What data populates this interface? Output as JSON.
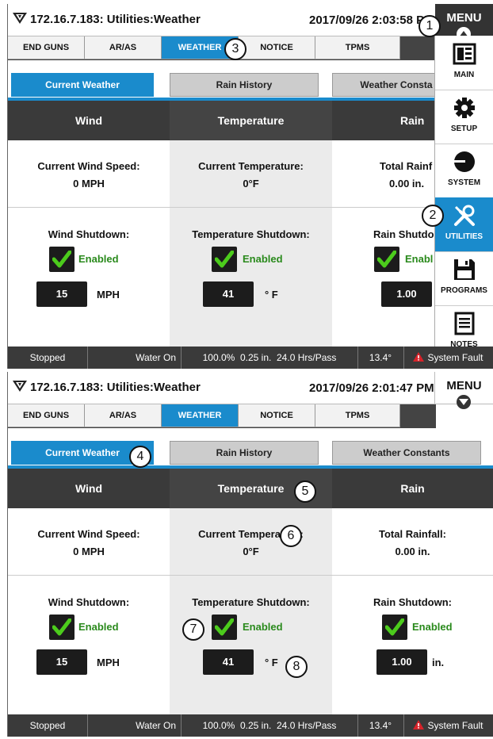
{
  "screens": [
    {
      "title": "172.16.7.183: Utilities:Weather",
      "datetime": "2017/09/26 2:03:58 PM",
      "menu_label": "MENU",
      "menu_open": true
    },
    {
      "title": "172.16.7.183: Utilities:Weather",
      "datetime": "2017/09/26 2:01:47 PM",
      "menu_label": "MENU",
      "menu_open": false
    }
  ],
  "tabs": [
    "END GUNS",
    "AR/AS",
    "WEATHER",
    "NOTICE",
    "TPMS"
  ],
  "active_tab": "WEATHER",
  "subtabs": [
    "Current Weather",
    "Rain History",
    "Weather Constants"
  ],
  "subtabs_partial": [
    "Current Weather",
    "Rain History",
    "Weather Consta"
  ],
  "active_subtab": "Current Weather",
  "columns": {
    "wind": {
      "header": "Wind",
      "current_label": "Current Wind Speed:",
      "current_value": "0 MPH",
      "shutdown_label": "Wind Shutdown:",
      "enabled_label": "Enabled",
      "threshold": "15",
      "unit": "MPH"
    },
    "temperature": {
      "header": "Temperature",
      "current_label": "Current Temperature:",
      "current_value": "0°F",
      "shutdown_label": "Temperature Shutdown:",
      "enabled_label": "Enabled",
      "threshold": "41",
      "unit": "° F"
    },
    "rain": {
      "header": "Rain",
      "current_label": "Total Rainfall:",
      "current_value": "0.00 in.",
      "shutdown_label": "Rain Shutdown:",
      "enabled_label": "Enabled",
      "threshold": "1.00",
      "unit": "in."
    }
  },
  "rain_partial": {
    "current_label": "Total Rainf",
    "current_value": "0.00 in.",
    "shutdown_label": "Rain Shutdo",
    "enabled_label": "Enabl",
    "unit": "in"
  },
  "status_bar": {
    "state": "Stopped",
    "water": "Water On",
    "info": "100.0%  0.25 in.  24.0 Hrs/Pass",
    "angle": "13.4°",
    "fault": "System Fault"
  },
  "side_menu": [
    {
      "label": "MAIN",
      "icon": "main-icon"
    },
    {
      "label": "SETUP",
      "icon": "gear-icon"
    },
    {
      "label": "SYSTEM",
      "icon": "system-icon"
    },
    {
      "label": "UTILITIES",
      "icon": "utilities-icon"
    },
    {
      "label": "PROGRAMS",
      "icon": "save-icon"
    },
    {
      "label": "NOTES",
      "icon": "notes-icon"
    }
  ],
  "callouts": [
    "1",
    "2",
    "3",
    "4",
    "5",
    "6",
    "7",
    "8"
  ],
  "colors": {
    "accent": "#1a8bcc",
    "header_dark": "#3a3a3a",
    "enabled_green": "#2a8a1c",
    "check_green": "#4ccc1c",
    "fault_red": "#d8232a"
  }
}
